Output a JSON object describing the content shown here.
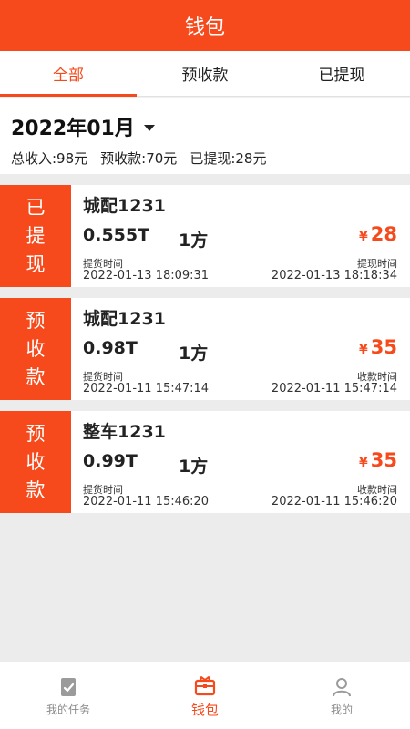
{
  "header": {
    "title": "钱包"
  },
  "tabs": [
    {
      "label": "全部",
      "active": true
    },
    {
      "label": "预收款",
      "active": false
    },
    {
      "label": "已提现",
      "active": false
    }
  ],
  "summary": {
    "month": "2022年01月",
    "total_income": "总收入:98元",
    "prepaid": "预收款:70元",
    "withdrawn": "已提现:28元"
  },
  "records": [
    {
      "status": "已提现",
      "status_chars": [
        "已",
        "提",
        "现"
      ],
      "route": "城配1231",
      "weight": "0.555T",
      "volume": "1方",
      "currency": "¥",
      "amount": "28",
      "left_label": "提货时间",
      "left_time": "2022-01-13 18:09:31",
      "right_label": "提现时间",
      "right_time": "2022-01-13 18:18:34"
    },
    {
      "status": "预收款",
      "status_chars": [
        "预",
        "收",
        "款"
      ],
      "route": "城配1231",
      "weight": "0.98T",
      "volume": "1方",
      "currency": "¥",
      "amount": "35",
      "left_label": "提货时间",
      "left_time": "2022-01-11 15:47:14",
      "right_label": "收款时间",
      "right_time": "2022-01-11 15:47:14"
    },
    {
      "status": "预收款",
      "status_chars": [
        "预",
        "收",
        "款"
      ],
      "route": "整车1231",
      "weight": "0.99T",
      "volume": "1方",
      "currency": "¥",
      "amount": "35",
      "left_label": "提货时间",
      "left_time": "2022-01-11 15:46:20",
      "right_label": "收款时间",
      "right_time": "2022-01-11 15:46:20"
    }
  ],
  "bottom_nav": [
    {
      "label": "我的任务",
      "icon": "task-icon",
      "active": false
    },
    {
      "label": "钱包",
      "icon": "wallet-icon",
      "active": true
    },
    {
      "label": "我的",
      "icon": "profile-icon",
      "active": false
    }
  ],
  "colors": {
    "accent": "#f64a1c",
    "text": "#222222",
    "muted": "#8a8a8a"
  }
}
